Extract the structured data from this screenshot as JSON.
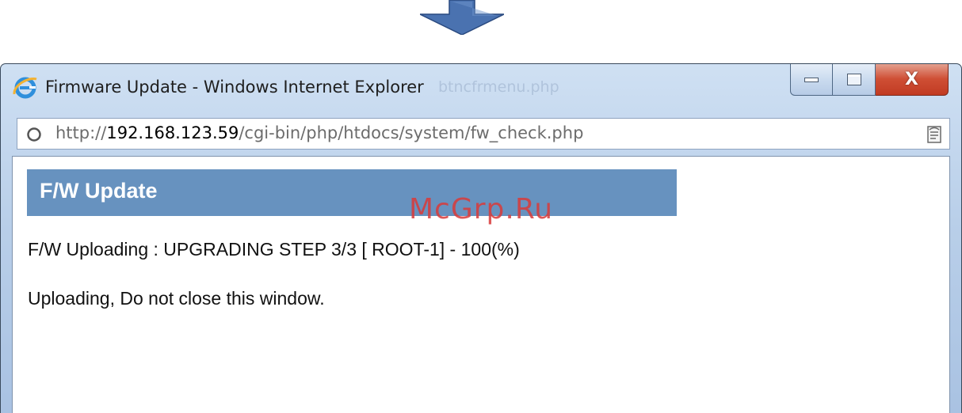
{
  "window": {
    "title": "Firmware Update - Windows Internet Explorer",
    "background_ghost_text": "btncfrmenu.php",
    "buttons": {
      "minimize": "minimize",
      "maximize": "maximize",
      "close": "X"
    }
  },
  "address_bar": {
    "url_prefix": "http://",
    "url_host": "192.168.123.59",
    "url_path": "/cgi-bin/php/htdocs/system/fw_check.php"
  },
  "page": {
    "header_title": "F/W Update",
    "status_line": "F/W Uploading : UPGRADING STEP 3/3 [ ROOT-1] - 100(%)",
    "notice_line": "Uploading, Do not close this window."
  },
  "watermark": "McGrp.Ru",
  "colors": {
    "header_bar": "#6792bf",
    "close_button": "#c94a31",
    "arrow": "#4a72b0",
    "watermark": "#d93a3a"
  },
  "icons": [
    "down-arrow-icon",
    "internet-explorer-icon",
    "page-loading-icon",
    "compatibility-view-icon"
  ]
}
